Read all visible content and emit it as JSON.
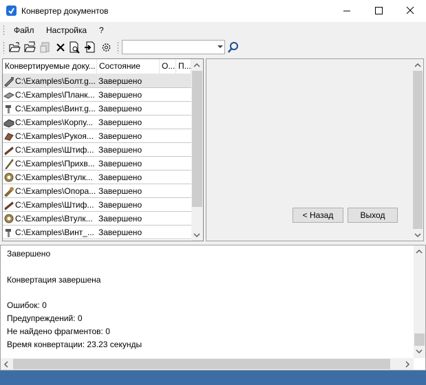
{
  "window": {
    "title": "Конвертер документов"
  },
  "menu": {
    "items": [
      "Файл",
      "Настройка",
      "?"
    ]
  },
  "toolbar": {
    "buttons": [
      "open-file-icon",
      "open-folder-icon",
      "convert-icon",
      "delete-icon",
      "preview-icon",
      "export-icon",
      "settings-gear-icon"
    ],
    "search": {
      "value": ""
    }
  },
  "file_list": {
    "columns": [
      "Конвертируемые доку...",
      "Состояние",
      "О...",
      "П..."
    ],
    "rows": [
      {
        "path": "C:\\Examples\\Болт.g...",
        "state": "Завершено",
        "icon": "bolt-part-icon"
      },
      {
        "path": "C:\\Examples\\Планк...",
        "state": "Завершено",
        "icon": "plank-part-icon"
      },
      {
        "path": "C:\\Examples\\Винт.g...",
        "state": "Завершено",
        "icon": "screw-part-icon"
      },
      {
        "path": "C:\\Examples\\Корпу...",
        "state": "Завершено",
        "icon": "housing-part-icon"
      },
      {
        "path": "C:\\Examples\\Рукоя...",
        "state": "Завершено",
        "icon": "handle-part-icon"
      },
      {
        "path": "C:\\Examples\\Штиф...",
        "state": "Завершено",
        "icon": "pin-part-icon"
      },
      {
        "path": "C:\\Examples\\Прихв...",
        "state": "Завершено",
        "icon": "clamp-part-icon"
      },
      {
        "path": "C:\\Examples\\Втулк...",
        "state": "Завершено",
        "icon": "bushing-part-icon"
      },
      {
        "path": "C:\\Examples\\Опора...",
        "state": "Завершено",
        "icon": "support-part-icon"
      },
      {
        "path": "C:\\Examples\\Штиф...",
        "state": "Завершено",
        "icon": "pin-part-icon"
      },
      {
        "path": "C:\\Examples\\Втулк...",
        "state": "Завершено",
        "icon": "bushing-part-icon"
      },
      {
        "path": "C:\\Examples\\Винт_...",
        "state": "Завершено",
        "icon": "screw-part-icon"
      }
    ]
  },
  "wizard": {
    "back_label": "< Назад",
    "exit_label": "Выход"
  },
  "log": {
    "lines": [
      "Завершено",
      "",
      "Конвертация завершена",
      "",
      "Ошибок: 0",
      "Предупреждений: 0",
      "Не найдено фрагментов: 0",
      "Время конвертации: 23.23 секунды"
    ]
  },
  "colors": {
    "accent": "#3c6ea5",
    "selection": "#e5e5e5",
    "app_icon": "#1e6fd9"
  }
}
